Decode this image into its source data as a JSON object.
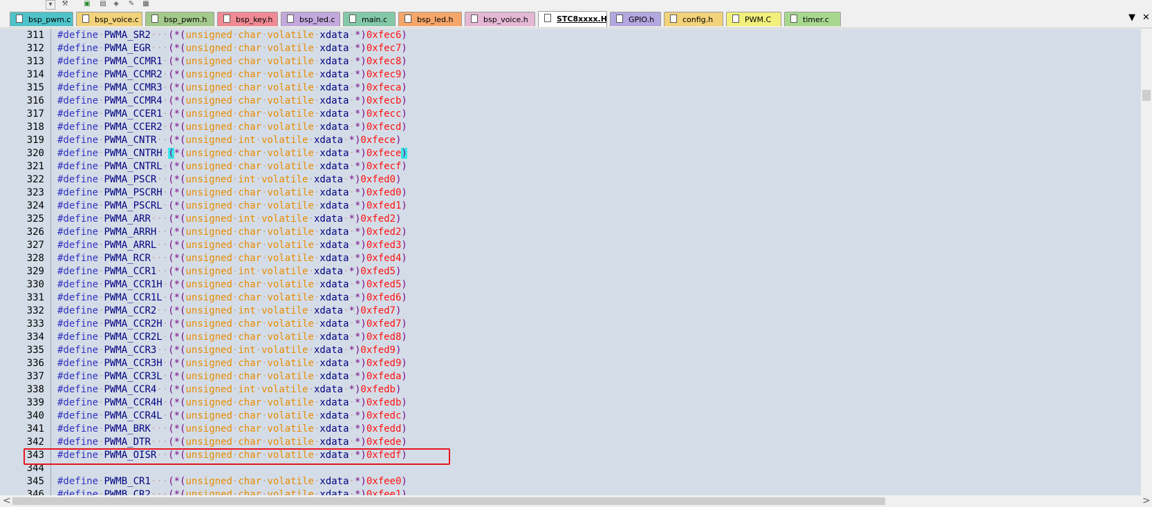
{
  "toolbar": {
    "icons": [
      "dropdown-icon",
      "tool-icon",
      "window-icon",
      "print-icon",
      "layers-icon",
      "wand-icon",
      "image-icon"
    ]
  },
  "tabs": [
    {
      "label": "bsp_pwm.c",
      "color": "#4fc3c9"
    },
    {
      "label": "bsp_voice.c",
      "color": "#f2d27a"
    },
    {
      "label": "bsp_pwm.h",
      "color": "#a4c98c"
    },
    {
      "label": "bsp_key.h",
      "color": "#f08a94"
    },
    {
      "label": "bsp_led.c",
      "color": "#c2a8dc"
    },
    {
      "label": "main.c",
      "color": "#84c8a8"
    },
    {
      "label": "bsp_led.h",
      "color": "#f6a66a"
    },
    {
      "label": "bsp_voice.h",
      "color": "#e4b8d4"
    },
    {
      "label": "STC8xxxx.H",
      "color": "#ffffff",
      "active": true
    },
    {
      "label": "GPIO.h",
      "color": "#b4a8e0"
    },
    {
      "label": "config.h",
      "color": "#f2d27a"
    },
    {
      "label": "PWM.C",
      "color": "#f2f07c"
    },
    {
      "label": "timer.c",
      "color": "#a8d890"
    }
  ],
  "tab_controls": {
    "dropdown": "▼",
    "close": "✕"
  },
  "code_lines": [
    {
      "num": "311",
      "name": "PWMA_SR2",
      "type": "char",
      "addr": "0xfec6"
    },
    {
      "num": "312",
      "name": "PWMA_EGR",
      "type": "char",
      "addr": "0xfec7"
    },
    {
      "num": "313",
      "name": "PWMA_CCMR1",
      "type": "char",
      "addr": "0xfec8"
    },
    {
      "num": "314",
      "name": "PWMA_CCMR2",
      "type": "char",
      "addr": "0xfec9"
    },
    {
      "num": "315",
      "name": "PWMA_CCMR3",
      "type": "char",
      "addr": "0xfeca"
    },
    {
      "num": "316",
      "name": "PWMA_CCMR4",
      "type": "char",
      "addr": "0xfecb"
    },
    {
      "num": "317",
      "name": "PWMA_CCER1",
      "type": "char",
      "addr": "0xfecc"
    },
    {
      "num": "318",
      "name": "PWMA_CCER2",
      "type": "char",
      "addr": "0xfecd"
    },
    {
      "num": "319",
      "name": "PWMA_CNTR",
      "type": "int",
      "addr": "0xfece"
    },
    {
      "num": "320",
      "name": "PWMA_CNTRH",
      "type": "char",
      "addr": "0xfece",
      "brace": true
    },
    {
      "num": "321",
      "name": "PWMA_CNTRL",
      "type": "char",
      "addr": "0xfecf"
    },
    {
      "num": "322",
      "name": "PWMA_PSCR",
      "type": "int",
      "addr": "0xfed0"
    },
    {
      "num": "323",
      "name": "PWMA_PSCRH",
      "type": "char",
      "addr": "0xfed0"
    },
    {
      "num": "324",
      "name": "PWMA_PSCRL",
      "type": "char",
      "addr": "0xfed1"
    },
    {
      "num": "325",
      "name": "PWMA_ARR",
      "type": "int",
      "addr": "0xfed2"
    },
    {
      "num": "326",
      "name": "PWMA_ARRH",
      "type": "char",
      "addr": "0xfed2"
    },
    {
      "num": "327",
      "name": "PWMA_ARRL",
      "type": "char",
      "addr": "0xfed3"
    },
    {
      "num": "328",
      "name": "PWMA_RCR",
      "type": "char",
      "addr": "0xfed4"
    },
    {
      "num": "329",
      "name": "PWMA_CCR1",
      "type": "int",
      "addr": "0xfed5"
    },
    {
      "num": "330",
      "name": "PWMA_CCR1H",
      "type": "char",
      "addr": "0xfed5"
    },
    {
      "num": "331",
      "name": "PWMA_CCR1L",
      "type": "char",
      "addr": "0xfed6"
    },
    {
      "num": "332",
      "name": "PWMA_CCR2",
      "type": "int",
      "addr": "0xfed7"
    },
    {
      "num": "333",
      "name": "PWMA_CCR2H",
      "type": "char",
      "addr": "0xfed7"
    },
    {
      "num": "334",
      "name": "PWMA_CCR2L",
      "type": "char",
      "addr": "0xfed8"
    },
    {
      "num": "335",
      "name": "PWMA_CCR3",
      "type": "int",
      "addr": "0xfed9"
    },
    {
      "num": "336",
      "name": "PWMA_CCR3H",
      "type": "char",
      "addr": "0xfed9"
    },
    {
      "num": "337",
      "name": "PWMA_CCR3L",
      "type": "char",
      "addr": "0xfeda"
    },
    {
      "num": "338",
      "name": "PWMA_CCR4",
      "type": "int",
      "addr": "0xfedb"
    },
    {
      "num": "339",
      "name": "PWMA_CCR4H",
      "type": "char",
      "addr": "0xfedb"
    },
    {
      "num": "340",
      "name": "PWMA_CCR4L",
      "type": "char",
      "addr": "0xfedc"
    },
    {
      "num": "341",
      "name": "PWMA_BRK",
      "type": "char",
      "addr": "0xfedd",
      "highlighted": true
    },
    {
      "num": "342",
      "name": "PWMA_DTR",
      "type": "char",
      "addr": "0xfede"
    },
    {
      "num": "343",
      "name": "PWMA_OISR",
      "type": "char",
      "addr": "0xfedf"
    },
    {
      "num": "344",
      "blank": true
    },
    {
      "num": "345",
      "name": "PWMB_CR1",
      "type": "char",
      "addr": "0xfee0"
    },
    {
      "num": "346",
      "name": "PWMB_CR2",
      "type": "char",
      "addr": "0xfee1"
    }
  ],
  "syntax": {
    "define": "#define",
    "unsigned": "unsigned",
    "volatile": "volatile",
    "xdata": "xdata",
    "open": "(*(",
    "star_close": "*)"
  },
  "colors": {
    "editor_bg": "#d4dde7",
    "keyword": "#3030c0",
    "identifier": "#000080",
    "punct": "#7a0a8a",
    "type": "#e88a00",
    "hex": "#ff1010",
    "highlight_box": "#e8141c",
    "brace_match": "#3ae6e6"
  },
  "scroll": {
    "left_arrow": "<",
    "right_arrow": ">"
  }
}
